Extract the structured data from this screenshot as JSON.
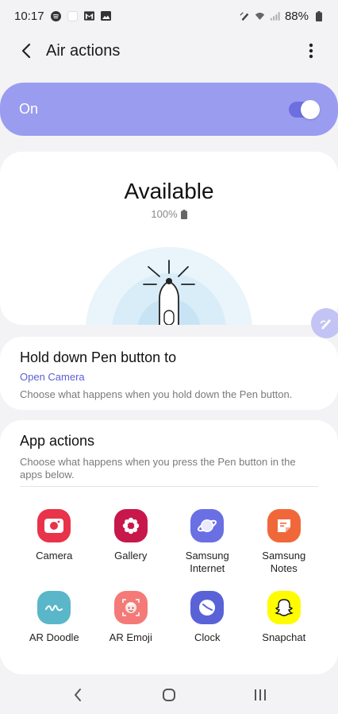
{
  "status_bar": {
    "time": "10:17",
    "battery_percent": "88%",
    "left_icons": [
      "spotify-icon",
      "blank-app-icon",
      "gmail-icon",
      "gallery-icon"
    ],
    "right_icons": [
      "spen-icon",
      "wifi-icon",
      "signal-icon",
      "battery-icon"
    ]
  },
  "app_bar": {
    "title": "Air actions"
  },
  "master_switch": {
    "label": "On",
    "enabled": true
  },
  "pen_status": {
    "title": "Available",
    "battery": "100%"
  },
  "hold_action": {
    "title": "Hold down Pen button to",
    "value": "Open Camera",
    "description": "Choose what happens when you hold down the Pen button."
  },
  "app_actions": {
    "title": "App actions",
    "description": "Choose what happens when you press the Pen button in the apps below.",
    "apps": [
      {
        "name": "Camera",
        "icon": "camera-icon",
        "color": "#e8334a"
      },
      {
        "name": "Gallery",
        "icon": "gallery-flower-icon",
        "color": "#c8174b"
      },
      {
        "name": "Samsung Internet",
        "icon": "planet-icon",
        "color": "#6a6fe3"
      },
      {
        "name": "Samsung Notes",
        "icon": "notes-icon",
        "color": "#f0683a"
      },
      {
        "name": "AR Doodle",
        "icon": "doodle-icon",
        "color": "#5ab7c9"
      },
      {
        "name": "AR Emoji",
        "icon": "emoji-face-icon",
        "color": "#f47a78"
      },
      {
        "name": "Clock",
        "icon": "clock-icon",
        "color": "#5a62d8"
      },
      {
        "name": "Snapchat",
        "icon": "ghost-icon",
        "color": "#fffc00"
      }
    ]
  },
  "colors": {
    "accent": "#9a9cf0",
    "link": "#5b5fd6",
    "background": "#f3f3f5"
  }
}
